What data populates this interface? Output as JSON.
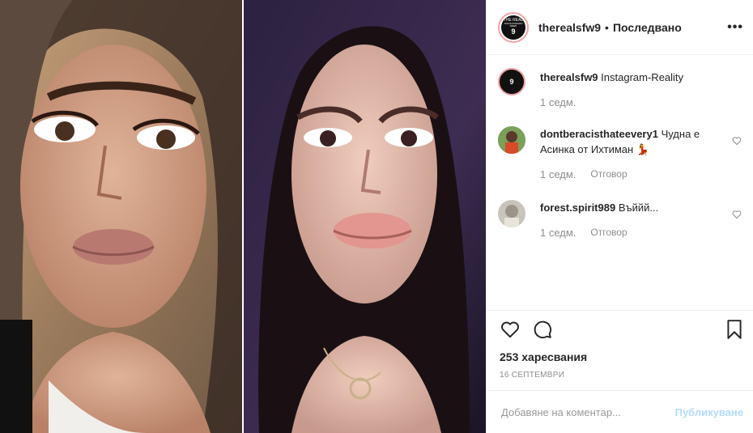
{
  "post": {
    "author": "therealsfw9",
    "separator": "•",
    "follow_status": "Последвано",
    "more_glyph": "•••",
    "avatar": {
      "line1": "THE REAL",
      "line2": "SOFIA FASHION WEEK",
      "number": "9"
    },
    "caption": {
      "user": "therealsfw9",
      "text": "Instagram-Reality",
      "time": "1 седм."
    },
    "comments": [
      {
        "user": "dontberacisthateevery1",
        "text": "Чудна е Асинка от Ихтиман 💃",
        "time": "1 седм.",
        "reply": "Отговор"
      },
      {
        "user": "forest.spirit989",
        "text": "Въййй...",
        "time": "1 седм.",
        "reply": "Отговор"
      }
    ],
    "likes": "253 харесвания",
    "date": "16 СЕПТЕМВРИ",
    "add_comment_placeholder": "Добавяне на коментар...",
    "publish_label": "Публикуване"
  },
  "colors": {
    "avatar_ring": "#f5a2a2",
    "publish_disabled": "#b3dbff",
    "meta_gray": "#8e8e8e",
    "border": "#efefef"
  }
}
